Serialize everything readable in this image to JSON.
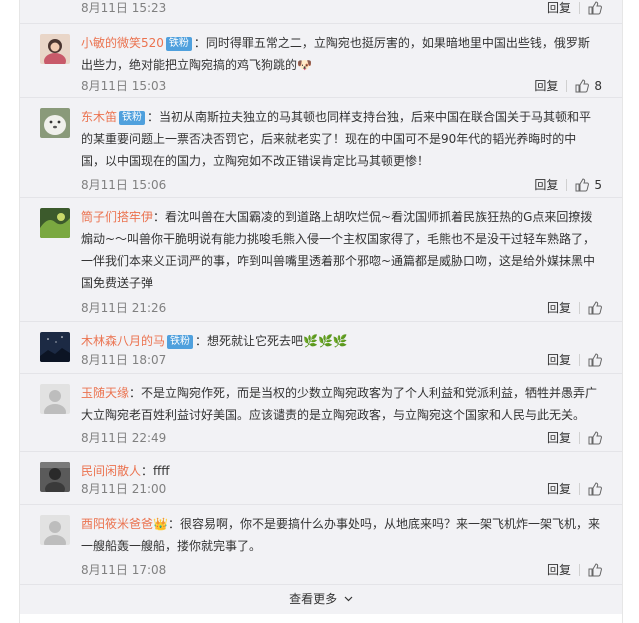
{
  "labels": {
    "reply": "回复",
    "more": "查看更多"
  },
  "comments": [
    {
      "user": "",
      "badge": "",
      "text": "",
      "time": "8月11日 15:23",
      "likes": ""
    },
    {
      "user": "小敏的微笑520",
      "badge": "铁粉",
      "text": "：同时得罪五常之二，立陶宛也挺厉害的，如果暗地里中国出些钱，俄罗斯出些力，绝对能把立陶宛搞的鸡飞狗跳的",
      "emoji": "🐶",
      "time": "8月11日 15:03",
      "likes": "8"
    },
    {
      "user": "东木笛",
      "badge": "铁粉",
      "text": "：当初从南斯拉夫独立的马其顿也同样支持台独，后来中国在联合国关于马其顿和平的某重要问题上一票否决否罚它，后来就老实了！现在的中国可不是90年代的韬光养晦时的中国，以中国现在的国力，立陶宛如不改正错误肯定比马其顿更惨！",
      "time": "8月11日 15:06",
      "likes": "5"
    },
    {
      "user": "筒子们搭牢伊",
      "badge": "",
      "text": "：看沈叫兽在大国霸凌的到道路上胡吹烂侃~看沈国师抓着民族狂热的G点来回撩拨煽动~～叫兽你干脆明说有能力挑唆毛熊入侵一个主权国家得了，毛熊也不是没干过轻车熟路了，一伴我们本来义正词严的事，咋到叫兽嘴里透着那个邪唿~通篇都是威胁口吻，这是给外媒抹黑中国免费送子弹",
      "time": "8月11日 21:26",
      "likes": ""
    },
    {
      "user": "木林森八月的马",
      "badge": "铁粉",
      "text": "：想死就让它死去吧",
      "emoji": "🌿🌿🌿",
      "time": "8月11日 18:07",
      "likes": ""
    },
    {
      "user": "玉随天缘",
      "badge": "",
      "text": "：不是立陶宛作死，而是当权的少数立陶宛政客为了个人利益和党派利益，牺牲并愚弄广大立陶宛老百姓利益讨好美国。应该谴责的是立陶宛政客，与立陶宛这个国家和人民与此无关。",
      "time": "8月11日 22:49",
      "likes": ""
    },
    {
      "user": "民间闲散人",
      "badge": "",
      "text": "：ffff",
      "time": "8月11日 21:00",
      "likes": ""
    },
    {
      "user": "酉阳筱米爸爸",
      "badge": "",
      "crown": "👑",
      "text": "：很容易啊，你不是要搞什么办事处吗，从地底来吗？来一架飞机炸一架飞机，来一艘船轰一艘船，搂你就完事了。",
      "time": "8月11日 17:08",
      "likes": ""
    }
  ],
  "colors": {
    "username": "#eb7350",
    "badge": "#4fa0dd",
    "panel": "#f2f2f5"
  }
}
